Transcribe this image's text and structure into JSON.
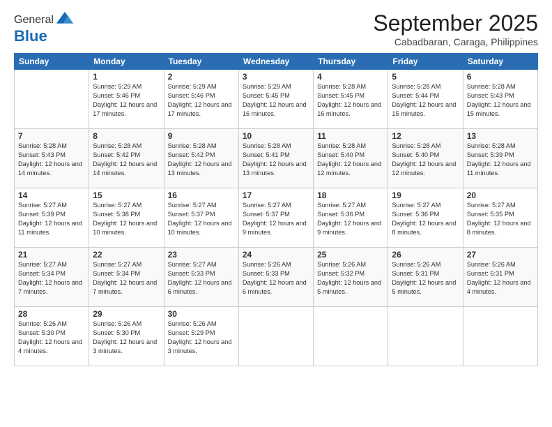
{
  "logo": {
    "general": "General",
    "blue": "Blue"
  },
  "header": {
    "month": "September 2025",
    "location": "Cabadbaran, Caraga, Philippines"
  },
  "weekdays": [
    "Sunday",
    "Monday",
    "Tuesday",
    "Wednesday",
    "Thursday",
    "Friday",
    "Saturday"
  ],
  "weeks": [
    [
      {
        "day": "",
        "sunrise": "",
        "sunset": "",
        "daylight": ""
      },
      {
        "day": "1",
        "sunrise": "Sunrise: 5:29 AM",
        "sunset": "Sunset: 5:46 PM",
        "daylight": "Daylight: 12 hours and 17 minutes."
      },
      {
        "day": "2",
        "sunrise": "Sunrise: 5:29 AM",
        "sunset": "Sunset: 5:46 PM",
        "daylight": "Daylight: 12 hours and 17 minutes."
      },
      {
        "day": "3",
        "sunrise": "Sunrise: 5:29 AM",
        "sunset": "Sunset: 5:45 PM",
        "daylight": "Daylight: 12 hours and 16 minutes."
      },
      {
        "day": "4",
        "sunrise": "Sunrise: 5:28 AM",
        "sunset": "Sunset: 5:45 PM",
        "daylight": "Daylight: 12 hours and 16 minutes."
      },
      {
        "day": "5",
        "sunrise": "Sunrise: 5:28 AM",
        "sunset": "Sunset: 5:44 PM",
        "daylight": "Daylight: 12 hours and 15 minutes."
      },
      {
        "day": "6",
        "sunrise": "Sunrise: 5:28 AM",
        "sunset": "Sunset: 5:43 PM",
        "daylight": "Daylight: 12 hours and 15 minutes."
      }
    ],
    [
      {
        "day": "7",
        "sunrise": "Sunrise: 5:28 AM",
        "sunset": "Sunset: 5:43 PM",
        "daylight": "Daylight: 12 hours and 14 minutes."
      },
      {
        "day": "8",
        "sunrise": "Sunrise: 5:28 AM",
        "sunset": "Sunset: 5:42 PM",
        "daylight": "Daylight: 12 hours and 14 minutes."
      },
      {
        "day": "9",
        "sunrise": "Sunrise: 5:28 AM",
        "sunset": "Sunset: 5:42 PM",
        "daylight": "Daylight: 12 hours and 13 minutes."
      },
      {
        "day": "10",
        "sunrise": "Sunrise: 5:28 AM",
        "sunset": "Sunset: 5:41 PM",
        "daylight": "Daylight: 12 hours and 13 minutes."
      },
      {
        "day": "11",
        "sunrise": "Sunrise: 5:28 AM",
        "sunset": "Sunset: 5:40 PM",
        "daylight": "Daylight: 12 hours and 12 minutes."
      },
      {
        "day": "12",
        "sunrise": "Sunrise: 5:28 AM",
        "sunset": "Sunset: 5:40 PM",
        "daylight": "Daylight: 12 hours and 12 minutes."
      },
      {
        "day": "13",
        "sunrise": "Sunrise: 5:28 AM",
        "sunset": "Sunset: 5:39 PM",
        "daylight": "Daylight: 12 hours and 11 minutes."
      }
    ],
    [
      {
        "day": "14",
        "sunrise": "Sunrise: 5:27 AM",
        "sunset": "Sunset: 5:39 PM",
        "daylight": "Daylight: 12 hours and 11 minutes."
      },
      {
        "day": "15",
        "sunrise": "Sunrise: 5:27 AM",
        "sunset": "Sunset: 5:38 PM",
        "daylight": "Daylight: 12 hours and 10 minutes."
      },
      {
        "day": "16",
        "sunrise": "Sunrise: 5:27 AM",
        "sunset": "Sunset: 5:37 PM",
        "daylight": "Daylight: 12 hours and 10 minutes."
      },
      {
        "day": "17",
        "sunrise": "Sunrise: 5:27 AM",
        "sunset": "Sunset: 5:37 PM",
        "daylight": "Daylight: 12 hours and 9 minutes."
      },
      {
        "day": "18",
        "sunrise": "Sunrise: 5:27 AM",
        "sunset": "Sunset: 5:36 PM",
        "daylight": "Daylight: 12 hours and 9 minutes."
      },
      {
        "day": "19",
        "sunrise": "Sunrise: 5:27 AM",
        "sunset": "Sunset: 5:36 PM",
        "daylight": "Daylight: 12 hours and 8 minutes."
      },
      {
        "day": "20",
        "sunrise": "Sunrise: 5:27 AM",
        "sunset": "Sunset: 5:35 PM",
        "daylight": "Daylight: 12 hours and 8 minutes."
      }
    ],
    [
      {
        "day": "21",
        "sunrise": "Sunrise: 5:27 AM",
        "sunset": "Sunset: 5:34 PM",
        "daylight": "Daylight: 12 hours and 7 minutes."
      },
      {
        "day": "22",
        "sunrise": "Sunrise: 5:27 AM",
        "sunset": "Sunset: 5:34 PM",
        "daylight": "Daylight: 12 hours and 7 minutes."
      },
      {
        "day": "23",
        "sunrise": "Sunrise: 5:27 AM",
        "sunset": "Sunset: 5:33 PM",
        "daylight": "Daylight: 12 hours and 6 minutes."
      },
      {
        "day": "24",
        "sunrise": "Sunrise: 5:26 AM",
        "sunset": "Sunset: 5:33 PM",
        "daylight": "Daylight: 12 hours and 6 minutes."
      },
      {
        "day": "25",
        "sunrise": "Sunrise: 5:26 AM",
        "sunset": "Sunset: 5:32 PM",
        "daylight": "Daylight: 12 hours and 5 minutes."
      },
      {
        "day": "26",
        "sunrise": "Sunrise: 5:26 AM",
        "sunset": "Sunset: 5:31 PM",
        "daylight": "Daylight: 12 hours and 5 minutes."
      },
      {
        "day": "27",
        "sunrise": "Sunrise: 5:26 AM",
        "sunset": "Sunset: 5:31 PM",
        "daylight": "Daylight: 12 hours and 4 minutes."
      }
    ],
    [
      {
        "day": "28",
        "sunrise": "Sunrise: 5:26 AM",
        "sunset": "Sunset: 5:30 PM",
        "daylight": "Daylight: 12 hours and 4 minutes."
      },
      {
        "day": "29",
        "sunrise": "Sunrise: 5:26 AM",
        "sunset": "Sunset: 5:30 PM",
        "daylight": "Daylight: 12 hours and 3 minutes."
      },
      {
        "day": "30",
        "sunrise": "Sunrise: 5:26 AM",
        "sunset": "Sunset: 5:29 PM",
        "daylight": "Daylight: 12 hours and 3 minutes."
      },
      {
        "day": "",
        "sunrise": "",
        "sunset": "",
        "daylight": ""
      },
      {
        "day": "",
        "sunrise": "",
        "sunset": "",
        "daylight": ""
      },
      {
        "day": "",
        "sunrise": "",
        "sunset": "",
        "daylight": ""
      },
      {
        "day": "",
        "sunrise": "",
        "sunset": "",
        "daylight": ""
      }
    ]
  ]
}
